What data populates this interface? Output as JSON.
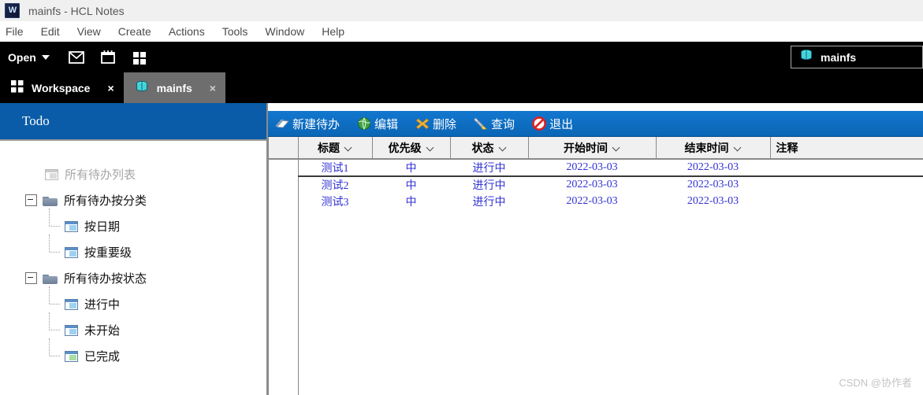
{
  "window": {
    "title": "mainfs - HCL Notes",
    "app_icon": "hcl-notes-icon"
  },
  "menubar": {
    "items": [
      {
        "label": "File"
      },
      {
        "label": "Edit"
      },
      {
        "label": "View"
      },
      {
        "label": "Create"
      },
      {
        "label": "Actions"
      },
      {
        "label": "Tools"
      },
      {
        "label": "Window"
      },
      {
        "label": "Help"
      }
    ]
  },
  "toolbar": {
    "open_label": "Open",
    "icons": [
      {
        "name": "mail-icon"
      },
      {
        "name": "calendar-icon"
      },
      {
        "name": "apps-grid-icon"
      }
    ],
    "bookmark": {
      "label": "mainfs",
      "icon": "database-icon"
    }
  },
  "tabs": [
    {
      "label": "Workspace",
      "icon": "apps-grid-icon",
      "active": false,
      "close": "×"
    },
    {
      "label": "mainfs",
      "icon": "database-icon",
      "active": true,
      "close": "×"
    }
  ],
  "sidebar": {
    "header_title": "Todo",
    "header_color": "#0a5ca8",
    "tree": [
      {
        "label": "所有待办列表",
        "icon": "view-icon",
        "level": 0,
        "dim": true,
        "twisty": false
      },
      {
        "label": "所有待办按分类",
        "icon": "folder-icon",
        "level": 0,
        "dim": false,
        "twisty": true
      },
      {
        "label": "按日期",
        "icon": "view-icon",
        "level": 1,
        "dim": false,
        "twisty": false
      },
      {
        "label": "按重要级",
        "icon": "view-icon",
        "level": 1,
        "dim": false,
        "twisty": false
      },
      {
        "label": "所有待办按状态",
        "icon": "folder-icon",
        "level": 0,
        "dim": false,
        "twisty": true
      },
      {
        "label": "进行中",
        "icon": "view-icon",
        "level": 1,
        "dim": false,
        "twisty": false
      },
      {
        "label": "未开始",
        "icon": "view-icon",
        "level": 1,
        "dim": false,
        "twisty": false
      },
      {
        "label": "已完成",
        "icon": "view-icon",
        "level": 1,
        "dim": false,
        "twisty": false
      }
    ]
  },
  "action_bar": {
    "accent_color": "#0a65b5",
    "buttons": [
      {
        "label": "新建待办",
        "icon": "book-icon"
      },
      {
        "label": "编辑",
        "icon": "globe-icon"
      },
      {
        "label": "删除",
        "icon": "x-mark-icon"
      },
      {
        "label": "查询",
        "icon": "flashlight-icon"
      },
      {
        "label": "退出",
        "icon": "prohibited-icon"
      }
    ]
  },
  "table": {
    "columns": [
      {
        "label": "",
        "sortable": false,
        "gutter": true
      },
      {
        "label": "标题",
        "sortable": true
      },
      {
        "label": "优先级",
        "sortable": true
      },
      {
        "label": "状态",
        "sortable": true
      },
      {
        "label": "开始时间",
        "sortable": true
      },
      {
        "label": "结束时间",
        "sortable": true
      },
      {
        "label": "注释",
        "sortable": false,
        "lead": true
      }
    ],
    "rows": [
      {
        "selected": true,
        "cells": [
          "",
          "测试1",
          "中",
          "进行中",
          "2022-03-03",
          "2022-03-03",
          ""
        ]
      },
      {
        "selected": false,
        "cells": [
          "",
          "测试2",
          "中",
          "进行中",
          "2022-03-03",
          "2022-03-03",
          ""
        ]
      },
      {
        "selected": false,
        "cells": [
          "",
          "测试3",
          "中",
          "进行中",
          "2022-03-03",
          "2022-03-03",
          ""
        ]
      }
    ],
    "link_color": "#3232d4"
  },
  "watermark": {
    "text": "CSDN @协作者"
  }
}
